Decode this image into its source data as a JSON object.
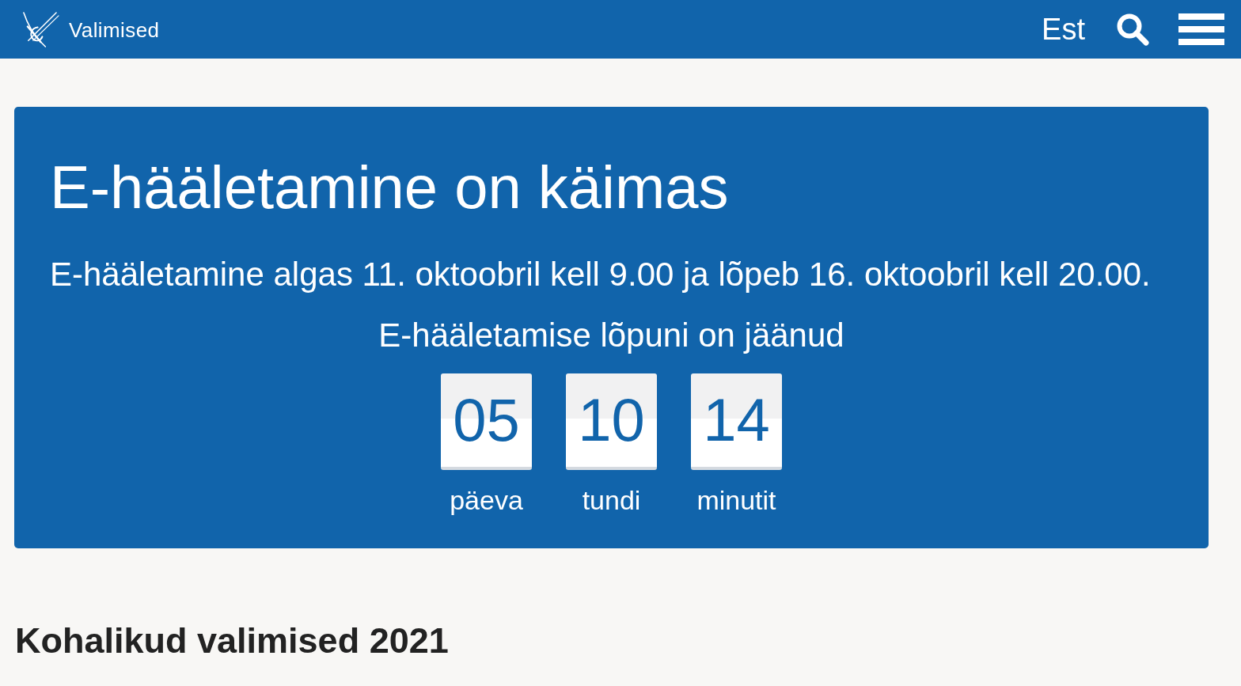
{
  "header": {
    "logo_text": "Valimised",
    "language": "Est"
  },
  "banner": {
    "title": "E-hääletamine on käimas",
    "subtitle": "E-hääletamine algas 11. oktoobril kell 9.00 ja lõpeb 16. oktoobril kell 20.00.",
    "countdown_label": "E-hääletamise lõpuni on jäänud",
    "countdown": [
      {
        "value": "05",
        "unit": "päeva"
      },
      {
        "value": "10",
        "unit": "tundi"
      },
      {
        "value": "14",
        "unit": "minutit"
      }
    ]
  },
  "section_title": "Kohalikud valimised 2021"
}
